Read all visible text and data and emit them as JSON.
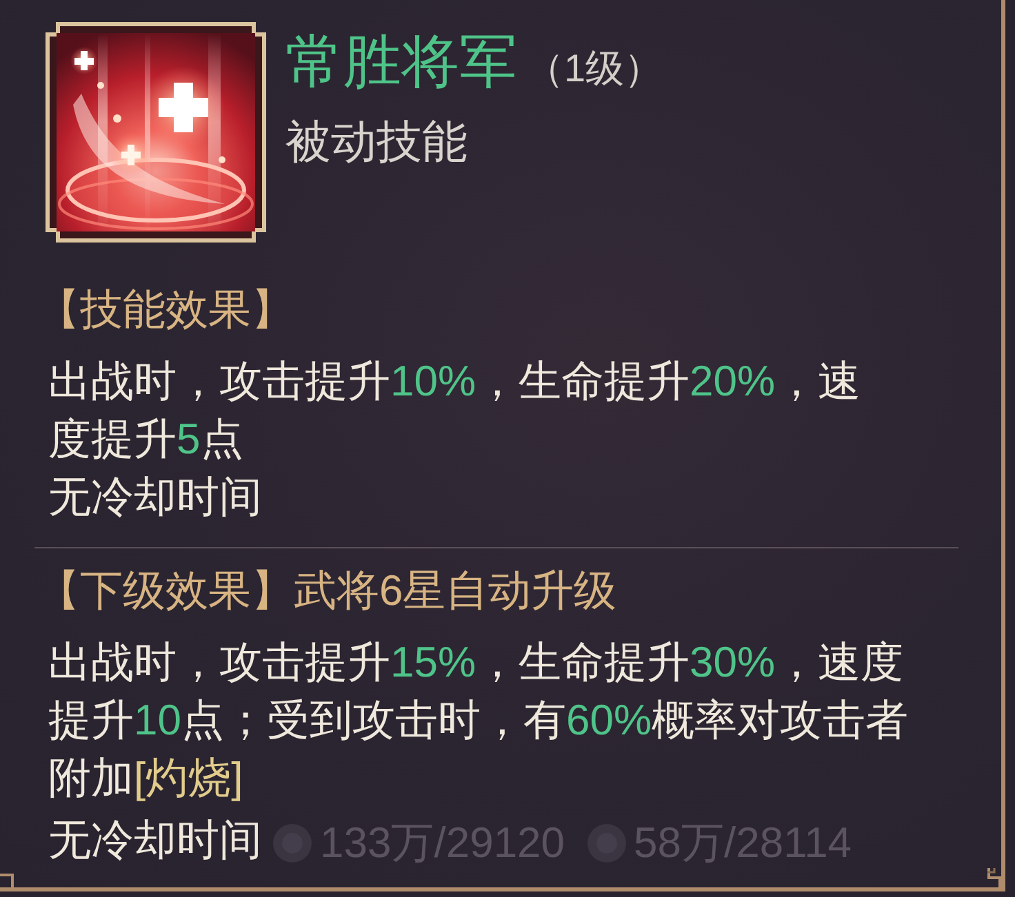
{
  "skill": {
    "name": "常胜将军",
    "level": "（1级）",
    "type": "被动技能"
  },
  "effect": {
    "heading": "【技能效果】",
    "lines": [
      [
        {
          "kind": "text",
          "text": "出战时，攻击提升"
        },
        {
          "kind": "value",
          "text": "10%"
        },
        {
          "kind": "text",
          "text": "，生命提升"
        },
        {
          "kind": "value",
          "text": "20%"
        },
        {
          "kind": "text",
          "text": "，速"
        }
      ],
      [
        {
          "kind": "text",
          "text": "度提升"
        },
        {
          "kind": "value",
          "text": "5"
        },
        {
          "kind": "text",
          "text": "点"
        }
      ]
    ],
    "cooldown": "无冷却时间"
  },
  "next_level": {
    "heading": "【下级效果】武将6星自动升级",
    "lines": [
      [
        {
          "kind": "text",
          "text": "出战时，攻击提升"
        },
        {
          "kind": "value",
          "text": "15%"
        },
        {
          "kind": "text",
          "text": "，生命提升"
        },
        {
          "kind": "value",
          "text": "30%"
        },
        {
          "kind": "text",
          "text": "，速度"
        }
      ],
      [
        {
          "kind": "text",
          "text": "提升"
        },
        {
          "kind": "value",
          "text": "10"
        },
        {
          "kind": "text",
          "text": "点；受到攻击时，有"
        },
        {
          "kind": "value",
          "text": "60%"
        },
        {
          "kind": "text",
          "text": "概率对攻击者"
        }
      ],
      [
        {
          "kind": "text",
          "text": "附加"
        },
        {
          "kind": "status",
          "text": "[灼烧]"
        }
      ]
    ],
    "cooldown": "无冷却时间"
  },
  "background_costs": [
    "133万/29120",
    "58万/28114"
  ]
}
